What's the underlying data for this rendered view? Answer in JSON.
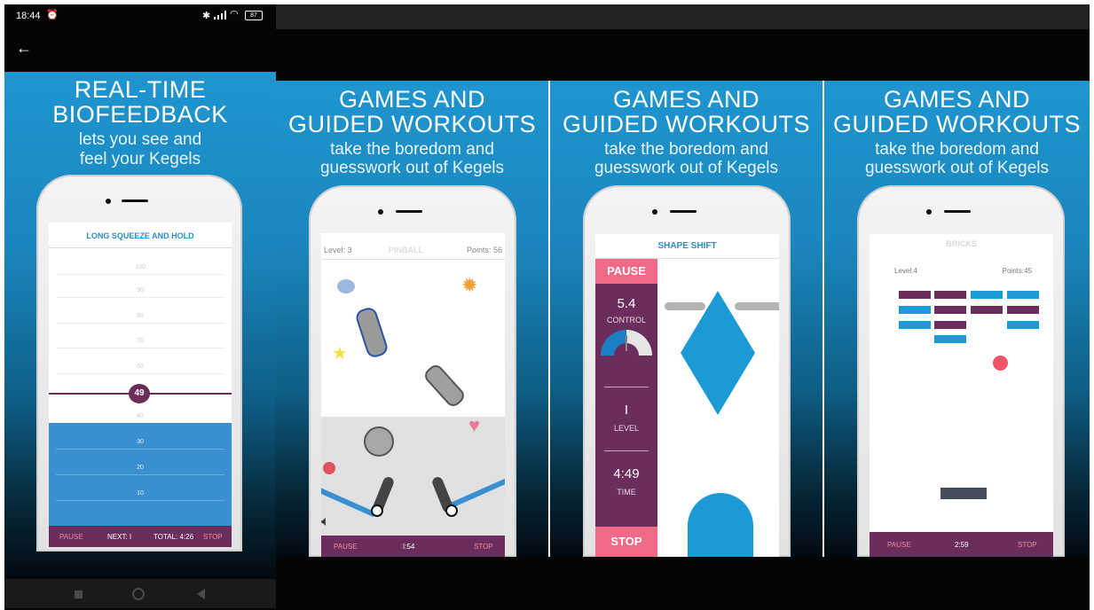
{
  "status_bar": {
    "time": "18:44",
    "battery": "87"
  },
  "panels": [
    {
      "headline_1": "REAL-TIME",
      "headline_2": "BIOFEEDBACK",
      "sub_1": "lets you see and",
      "sub_2": "feel your Kegels",
      "screen_title": "LONG SQUEEZE AND HOLD",
      "ticks": [
        "100",
        "90",
        "80",
        "70",
        "60",
        "40",
        "30",
        "20",
        "10"
      ],
      "current_value": "49",
      "bottom": {
        "pause": "PAUSE",
        "next": "NEXT: I",
        "total": "TOTAL: 4:26",
        "stop": "STOP"
      }
    },
    {
      "headline_1": "GAMES AND",
      "headline_2": "GUIDED WORKOUTS",
      "sub_1": "take the boredom and",
      "sub_2": "guesswork out of Kegels",
      "level": "Level: 3",
      "game": "PINBALL",
      "points": "Points: 56",
      "bottom": {
        "pause": "PAUSE",
        "time": "I:54",
        "stop": "STOP"
      }
    },
    {
      "headline_1": "GAMES AND",
      "headline_2": "GUIDED WORKOUTS",
      "sub_1": "take the boredom and",
      "sub_2": "guesswork out of Kegels",
      "game": "SHAPE SHIFT",
      "pause": "PAUSE",
      "control_value": "5.4",
      "control_label": "CONTROL",
      "level_value": "I",
      "level_label": "LEVEL",
      "time_value": "4:49",
      "time_label": "TIME",
      "stop": "STOP"
    },
    {
      "headline_1": "GAMES AND",
      "headline_2": "GUIDED WORKOUTS",
      "sub_1": "take the boredom and",
      "sub_2": "guesswork out of Kegels",
      "game": "BRICKS",
      "level": "Level:4",
      "points": "Points:45",
      "bottom": {
        "pause": "PAUSE",
        "time": "2:59",
        "stop": "STOP"
      }
    }
  ],
  "colors": {
    "purple": "#6b2d5c",
    "blue": "#1c9ad6",
    "pink": "#ee6a86",
    "red": "#ee5567"
  }
}
